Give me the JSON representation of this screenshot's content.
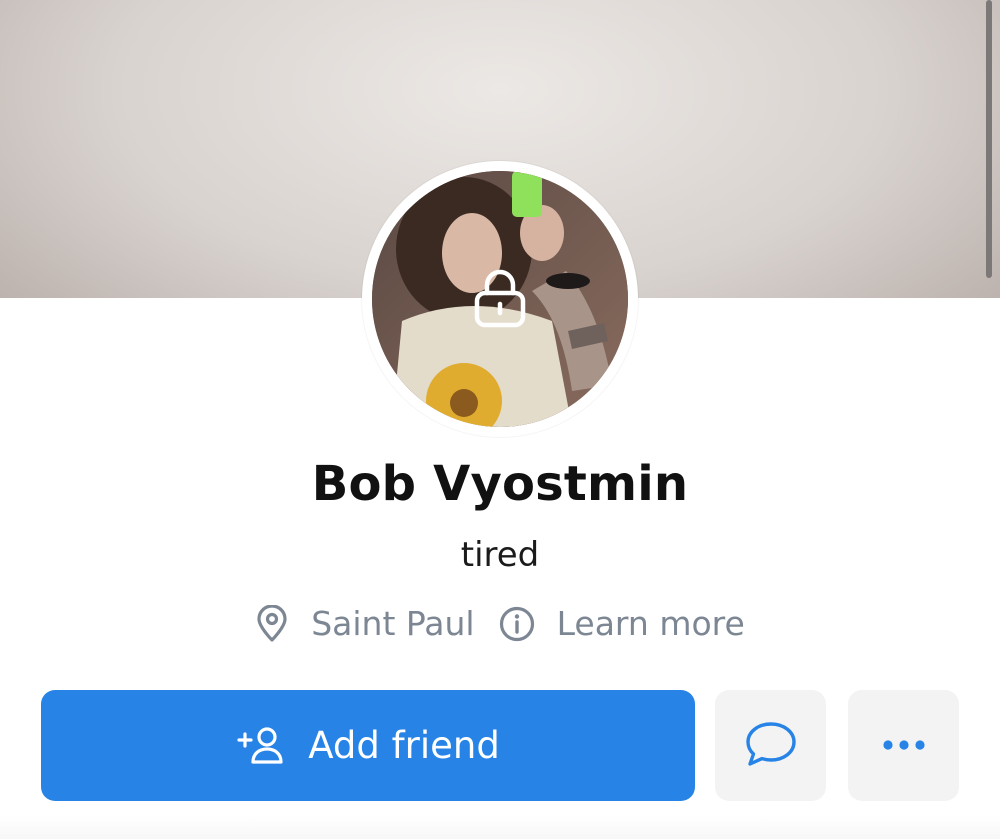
{
  "profile": {
    "name": "Bob Vyostmin",
    "status": "tired",
    "location": "Saint Paul",
    "learn_more": "Learn more"
  },
  "actions": {
    "add_friend": "Add friend",
    "message_icon": "chat-bubble-icon",
    "more_icon": "more-horizontal-icon"
  },
  "icons": {
    "lock": "lock-icon",
    "location": "map-pin-icon",
    "info": "info-circle-icon",
    "add_person": "add-person-icon"
  },
  "colors": {
    "primary": "#2784e6",
    "meta_text": "#7d8794",
    "button_bg": "#f3f3f4"
  }
}
